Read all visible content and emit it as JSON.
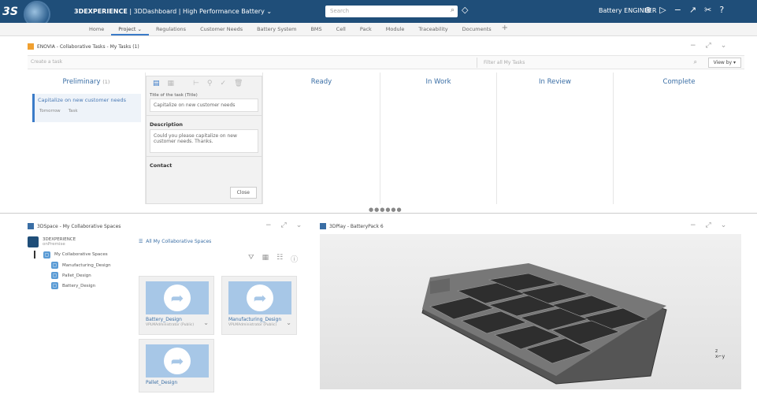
{
  "topbar": {
    "app_title_bold": "3DEXPERIENCE",
    "app_title_rest": " | 3DDashboard | High Performance Battery ⌄",
    "search_placeholder": "Search",
    "user": "Battery ENGINEER"
  },
  "tabs": [
    "Home",
    "Project ⌄",
    "Regulations",
    "Customer Needs",
    "Battery System",
    "BMS",
    "Cell",
    "Pack",
    "Module",
    "Traceability",
    "Documents",
    "+"
  ],
  "kanban": {
    "panel_title": "ENOVIA - Collaborative Tasks - My Tasks (1)",
    "create_placeholder": "Create a task",
    "filter_placeholder": "Filter all My Tasks",
    "view_by": "View by ▾",
    "columns": [
      {
        "title": "Preliminary",
        "count": "(1)"
      },
      {
        "title": "Ready",
        "count": ""
      },
      {
        "title": "In Work",
        "count": ""
      },
      {
        "title": "In Review",
        "count": ""
      },
      {
        "title": "Complete",
        "count": ""
      }
    ],
    "card": {
      "title": "Capitalize on new customer needs",
      "meta1": "Tomorrow",
      "meta2": "Task"
    },
    "editor": {
      "label": "Title of the task (Title)",
      "title_value": "Capitalize on new customer needs",
      "description_label": "Description",
      "description_value": "Could you please capitalize on new customer needs. Thanks.",
      "contact_label": "Contact",
      "close": "Close"
    }
  },
  "spaces": {
    "panel_title": "3DSpace - My Collaborative Spaces",
    "root": "3DEXPERIENCE",
    "root_sub": "onPremise",
    "tree": [
      "My Collaborative Spaces",
      "Manufacturing_Design",
      "Pallet_Design",
      "Battery_Design"
    ],
    "header": "All My Collaborative Spaces",
    "tiles": [
      {
        "name": "Battery_Design",
        "sub": "VPLMAdministrator (Public)"
      },
      {
        "name": "Manufacturing_Design",
        "sub": "VPLMAdministrator (Public)"
      },
      {
        "name": "Pallet_Design",
        "sub": ""
      }
    ]
  },
  "viewer": {
    "panel_title": "3DPlay - BatteryPack 6"
  },
  "colors": {
    "topbar": "#1f4e79",
    "accent": "#3a7bc8",
    "tile_blue": "#a7c7e7"
  }
}
